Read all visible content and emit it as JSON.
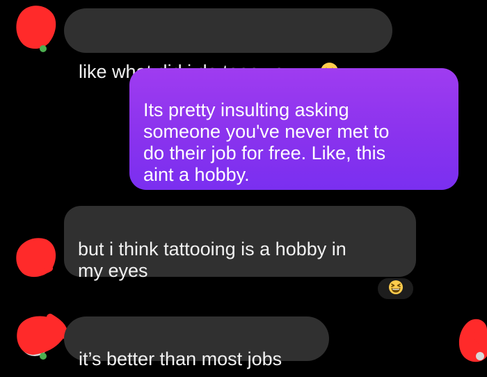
{
  "messages": [
    {
      "sender": "other",
      "text": "like what did i do tooo youuu",
      "emoji": "confused-face"
    },
    {
      "sender": "me",
      "text": "Its pretty insulting asking\nsomeone you've never met to\ndo their job for free. Like, this\naint a hobby."
    },
    {
      "sender": "other",
      "text": "but i think tattooing is a hobby in\nmy eyes",
      "reaction": "grinning-squinting-face"
    },
    {
      "sender": "other",
      "text": "it’s better than most jobs"
    }
  ],
  "colors": {
    "background": "#000000",
    "incoming_bubble": "#303030",
    "outgoing_bubble": "#8a33ee",
    "redaction": "#ff2a2a",
    "online_dot": "#4caf50"
  },
  "icons": {
    "avatar": "redacted-avatar",
    "online": "online-status-dot"
  }
}
